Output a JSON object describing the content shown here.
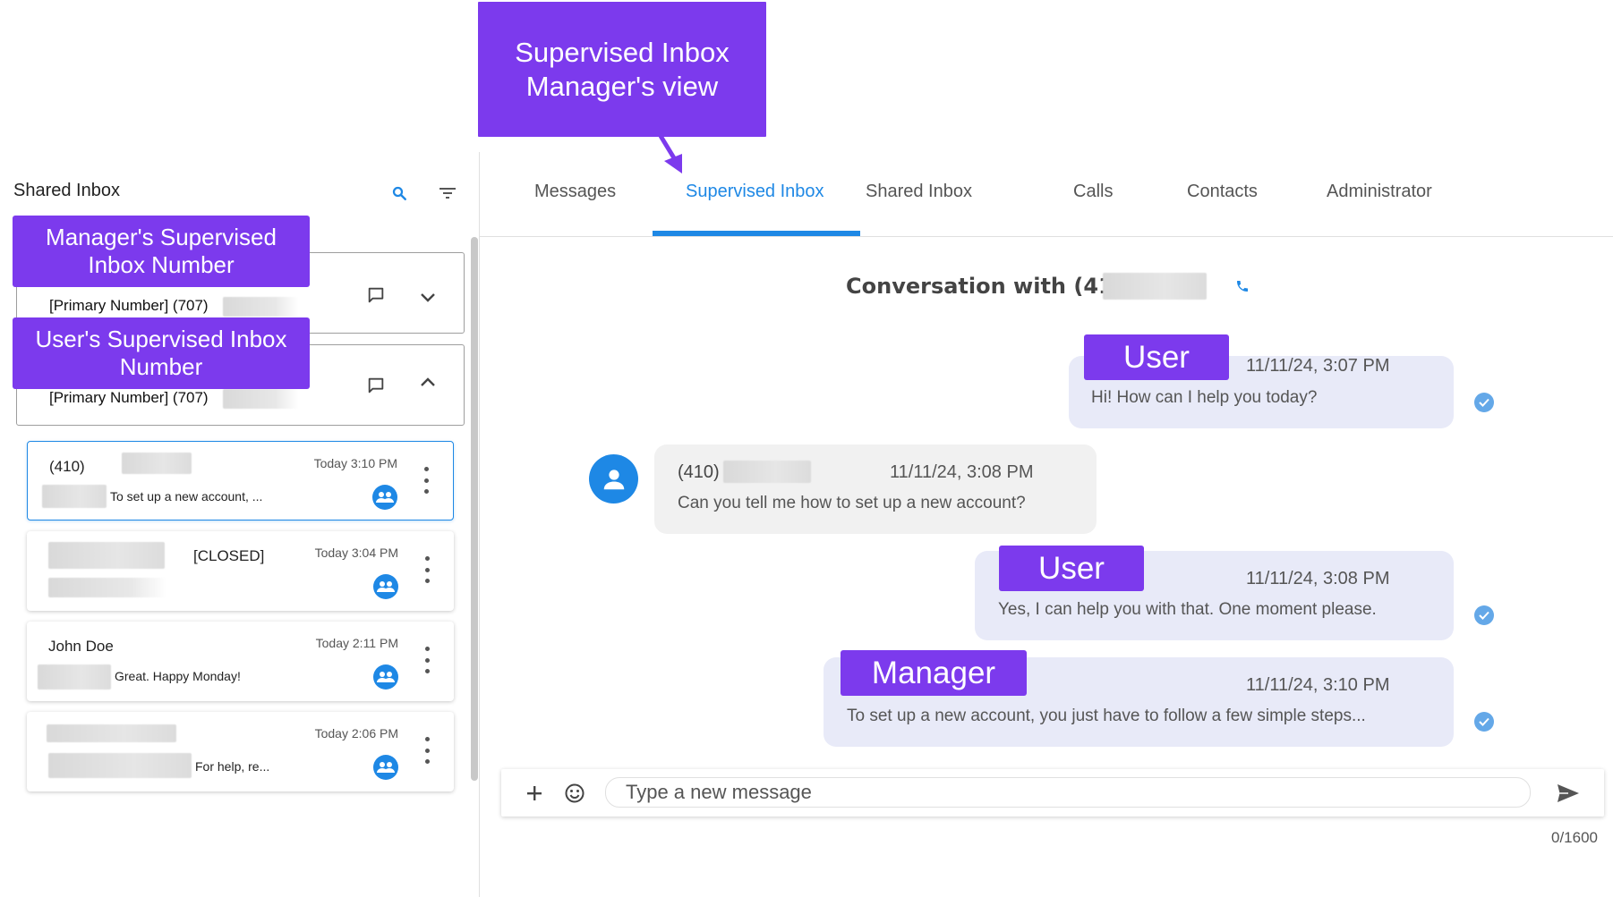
{
  "sidebar": {
    "title": "Shared Inbox",
    "icons": {
      "search": "search-icon",
      "filter": "filter-icon"
    },
    "numbers": [
      {
        "label": "[Primary Number] (707)",
        "expanded": false
      },
      {
        "label": "[Primary Number] (707)",
        "expanded": true
      }
    ],
    "conversations": [
      {
        "name": "(410)",
        "time": "Today 3:10 PM",
        "preview": "To set up a new account, ...",
        "active": true
      },
      {
        "name": "[CLOSED]",
        "time": "Today 3:04 PM",
        "preview": "",
        "active": false
      },
      {
        "name": "John Doe",
        "time": "Today 2:11 PM",
        "preview": "Great. Happy Monday!",
        "active": false
      },
      {
        "name": "",
        "time": "Today 2:06 PM",
        "preview": "For help, re...",
        "active": false
      }
    ]
  },
  "tabs": [
    {
      "label": "Messages",
      "active": false
    },
    {
      "label": "Supervised Inbox",
      "active": true
    },
    {
      "label": "Shared Inbox",
      "active": false
    },
    {
      "label": "Calls",
      "active": false
    },
    {
      "label": "Contacts",
      "active": false
    },
    {
      "label": "Administrator",
      "active": false
    }
  ],
  "conversation": {
    "title": "Conversation with (410)",
    "messages": [
      {
        "direction": "out",
        "time": "11/11/24, 3:07 PM",
        "text": "Hi! How can I help you today?"
      },
      {
        "direction": "in",
        "sender": "(410)",
        "time": "11/11/24, 3:08 PM",
        "text": "Can you tell me how to set up a new account?"
      },
      {
        "direction": "out",
        "time": "11/11/24, 3:08 PM",
        "text": "Yes, I can help you with that. One moment please."
      },
      {
        "direction": "out",
        "time": "11/11/24, 3:10 PM",
        "text": "To set up a new account, you just have to follow a few simple steps..."
      }
    ]
  },
  "composer": {
    "placeholder": "Type a new message",
    "counter": "0/1600"
  },
  "annotations": {
    "view_title": "Supervised Inbox Manager's view",
    "manager_number": "Manager's Supervised Inbox Number",
    "user_number": "User's Supervised Inbox Number",
    "msg1_tag": "User",
    "msg3_tag": "User",
    "msg4_tag": "Manager"
  },
  "colors": {
    "accent": "#1e88e5",
    "annotation": "#7c3aed",
    "outgoing_bubble": "#e8eaf8",
    "incoming_bubble": "#f1f1f1"
  }
}
